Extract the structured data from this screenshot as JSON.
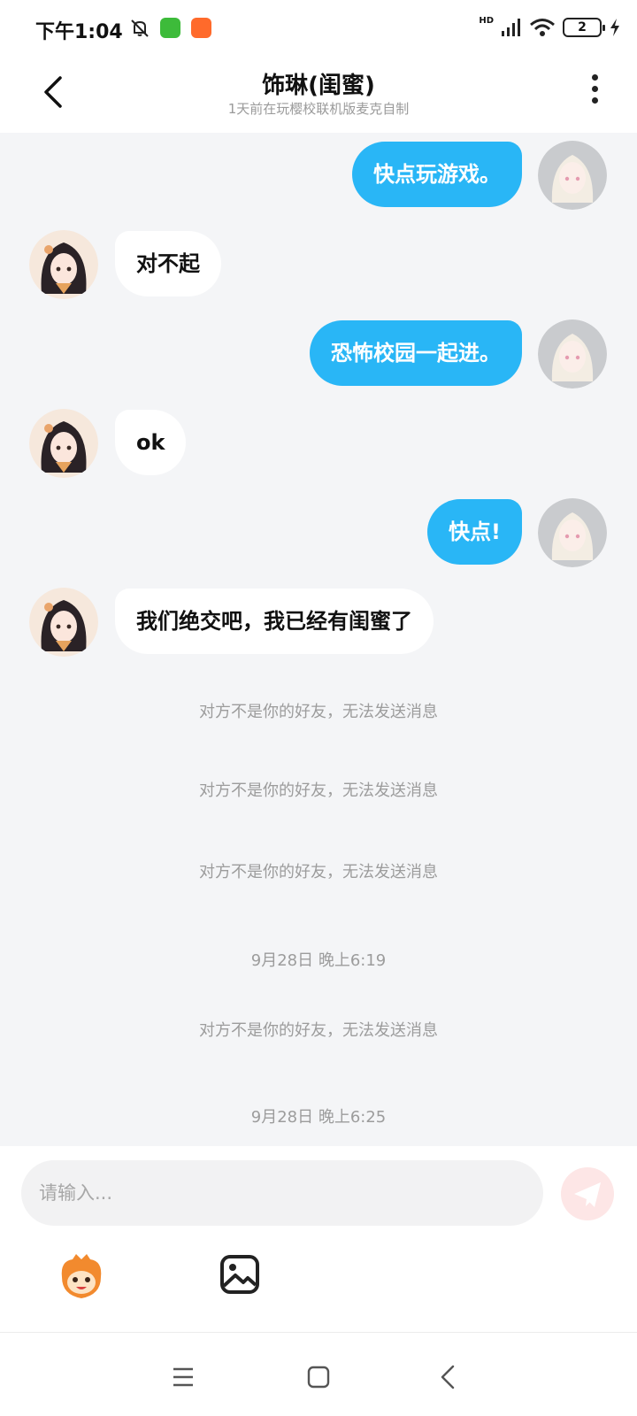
{
  "status_bar": {
    "time": "下午1:04",
    "icons": [
      "mute-icon",
      "wechat-app-icon",
      "taobao-app-icon",
      "signal-icon",
      "wifi-icon",
      "battery-icon",
      "charging-icon"
    ],
    "network_label": "HD",
    "battery_level": "2"
  },
  "header": {
    "title": "饰琳(闺蜜)",
    "subtitle": "1天前在玩樱校联机版麦克自制"
  },
  "colors": {
    "my_bubble": "#29b6f6",
    "their_bubble": "#ffffff",
    "chat_bg": "#f4f5f7",
    "system_text": "#9c9c9c"
  },
  "messages": [
    {
      "sender": "me",
      "text": "快点玩游戏。"
    },
    {
      "sender": "them",
      "text": "对不起"
    },
    {
      "sender": "me",
      "text": "恐怖校园一起进。"
    },
    {
      "sender": "them",
      "text": "ok"
    },
    {
      "sender": "me",
      "text": "快点!"
    },
    {
      "sender": "them",
      "text": "我们绝交吧，我已经有闺蜜了"
    }
  ],
  "system_notices": [
    "对方不是你的好友，无法发送消息",
    "对方不是你的好友，无法发送消息",
    "对方不是你的好友，无法发送消息",
    "9月28日 晚上6:19",
    "对方不是你的好友，无法发送消息",
    "9月28日 晚上6:25"
  ],
  "composer": {
    "placeholder": "请输入...",
    "value": ""
  },
  "toolbar_icons": [
    "emoji-mascot-icon",
    "image-icon"
  ],
  "nav_bar": [
    "menu-icon",
    "home-icon",
    "back-icon"
  ]
}
